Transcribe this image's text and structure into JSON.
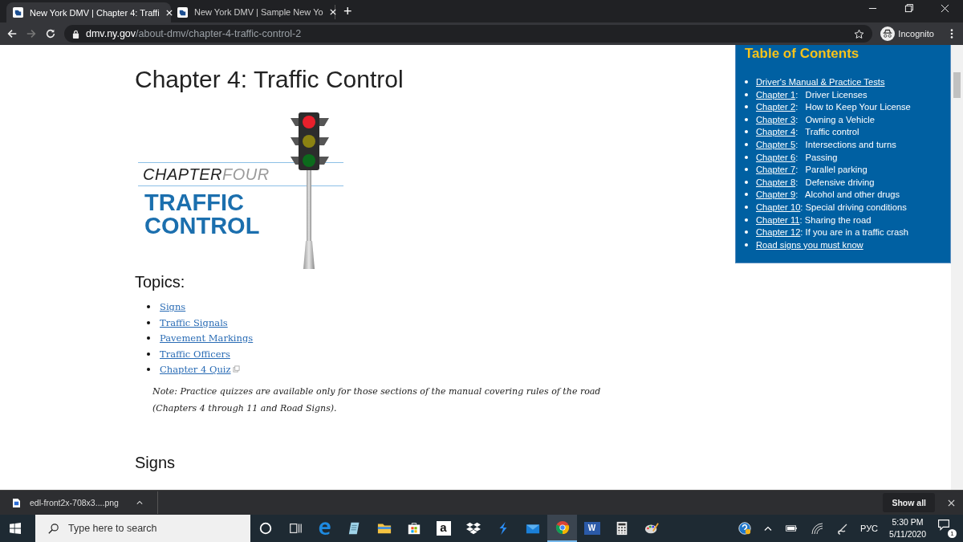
{
  "browser": {
    "tabs": [
      {
        "title": "New York DMV | Chapter 4: Traffi",
        "selected": true
      },
      {
        "title": "New York DMV | Sample New Yo",
        "selected": false
      }
    ],
    "new_tab": "+",
    "address": {
      "domain": "dmv.ny.gov",
      "path": "/about-dmv/chapter-4-traffic-control-2"
    },
    "profile": "Incognito"
  },
  "page": {
    "title": "Chapter 4: Traffic Control",
    "banner": {
      "chapter": "CHAPTER",
      "number": "FOUR",
      "line1": "TRAFFIC",
      "line2": "CONTROL"
    },
    "topics_heading": "Topics:",
    "topics": [
      {
        "label": "Signs",
        "external": false
      },
      {
        "label": "Traffic Signals",
        "external": false
      },
      {
        "label": "Pavement Markings",
        "external": false
      },
      {
        "label": "Traffic Officers",
        "external": false
      },
      {
        "label": "Chapter 4 Quiz",
        "external": true
      }
    ],
    "note": "Note:  Practice quizzes are available only for those sections of the manual covering rules of the road (Chapters 4 through 11 and Road Signs).",
    "section_heading": "Signs"
  },
  "toc": {
    "title": "Table of Contents",
    "items": [
      {
        "link": "Driver's Manual & Practice Tests"
      },
      {
        "link": "Chapter 1",
        "rest": ":   Driver Licenses"
      },
      {
        "link": "Chapter 2",
        "rest": ":   How to Keep Your License"
      },
      {
        "link": "Chapter 3",
        "rest": ":   Owning a Vehicle"
      },
      {
        "link": "Chapter 4",
        "rest": ":   Traffic control"
      },
      {
        "link": "Chapter 5",
        "rest": ":   Intersections and turns"
      },
      {
        "link": "Chapter 6",
        "rest": ":   Passing"
      },
      {
        "link": "Chapter 7",
        "rest": ":   Parallel parking"
      },
      {
        "link": "Chapter 8",
        "rest": ":   Defensive driving"
      },
      {
        "link": "Chapter 9",
        "rest": ":   Alcohol and other drugs"
      },
      {
        "link": "Chapter 10",
        "rest": ": Special driving conditions"
      },
      {
        "link": "Chapter 11",
        "rest": ": Sharing the road"
      },
      {
        "link": "Chapter 12",
        "rest": ": If you are in a traffic crash"
      },
      {
        "link": "Road signs you must know"
      }
    ]
  },
  "download_bar": {
    "file": "edl-front2x-708x3....png",
    "show_all": "Show all"
  },
  "taskbar": {
    "search_placeholder": "Type here to search",
    "apps": [
      {
        "kind": "cortana",
        "selected": false
      },
      {
        "kind": "taskview",
        "selected": false
      },
      {
        "kind": "edge",
        "selected": false
      },
      {
        "kind": "notepad",
        "selected": false
      },
      {
        "kind": "explorer",
        "selected": false
      },
      {
        "kind": "store",
        "selected": false
      },
      {
        "kind": "amazon",
        "label": "a",
        "selected": false
      },
      {
        "kind": "dropbox",
        "selected": false
      },
      {
        "kind": "bolt",
        "selected": false
      },
      {
        "kind": "mail",
        "selected": false
      },
      {
        "kind": "chrome",
        "selected": true
      },
      {
        "kind": "word",
        "label": "W",
        "selected": false
      },
      {
        "kind": "calculator",
        "selected": false
      },
      {
        "kind": "paint",
        "selected": false
      }
    ],
    "language": "РУС",
    "time": "5:30 PM",
    "date": "5/11/2020",
    "notifications": "1"
  }
}
